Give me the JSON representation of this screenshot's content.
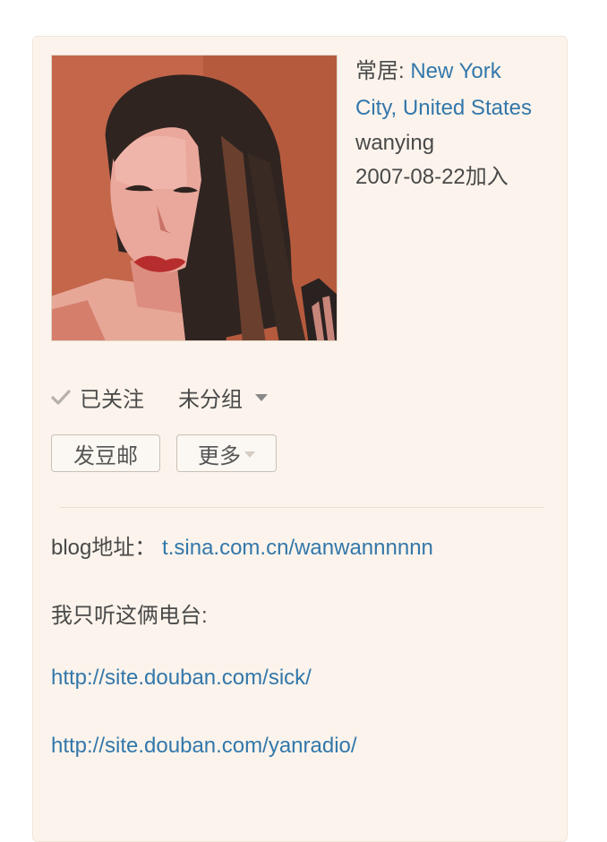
{
  "profile": {
    "location_label": "常居: ",
    "location_line1": "New York",
    "location_line2": "City, United States",
    "username": "wanying",
    "joined": "2007-08-22加入"
  },
  "follow": {
    "status": "已关注",
    "group": "未分组"
  },
  "buttons": {
    "mail": "发豆邮",
    "more": "更多"
  },
  "intro": {
    "blog_label": "blog地址：",
    "blog_link": "t.sina.com.cn/wanwannnnnn",
    "radio_text": "我只听这俩电台:",
    "link1": "http://site.douban.com/sick/",
    "link2": "http://site.douban.com/yanradio/"
  },
  "colors": {
    "card_bg": "#fcf4ec",
    "link": "#3377aa",
    "text": "#494949"
  }
}
